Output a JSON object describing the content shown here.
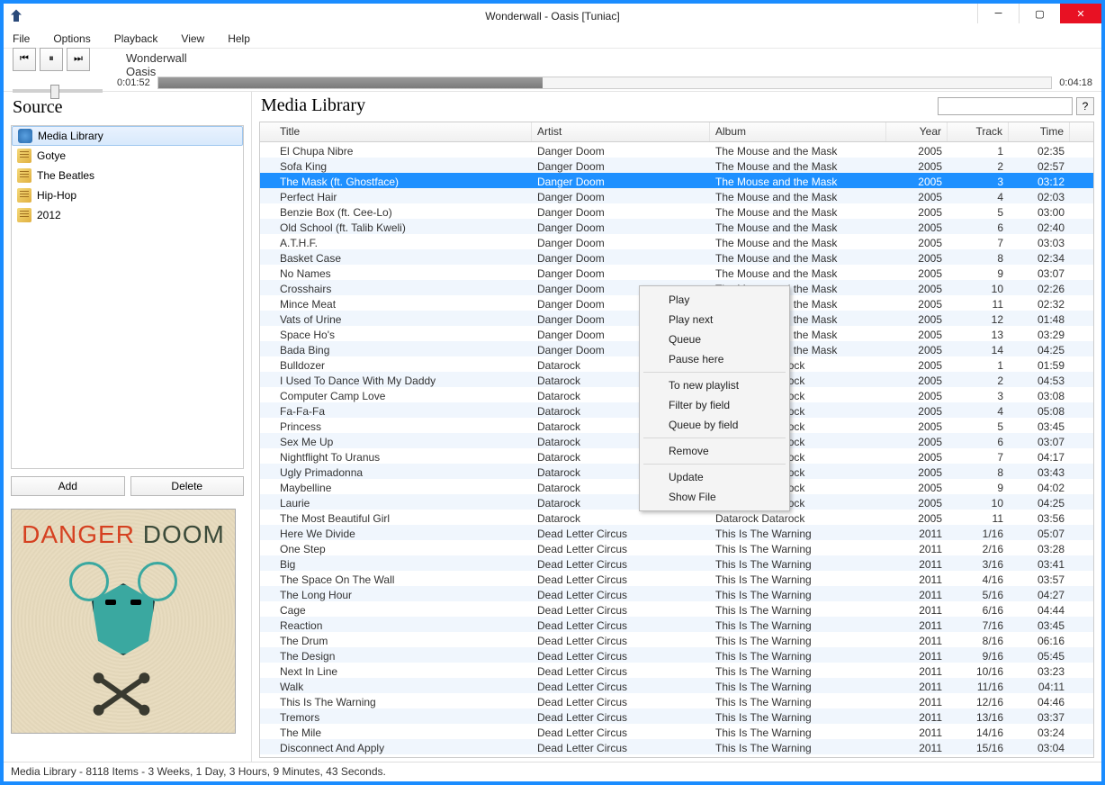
{
  "window": {
    "title": "Wonderwall - Oasis [Tuniac]"
  },
  "menu": {
    "file": "File",
    "options": "Options",
    "playback": "Playback",
    "view": "View",
    "help": "Help"
  },
  "player": {
    "track_title": "Wonderwall",
    "track_artist": "Oasis",
    "elapsed": "0:01:52",
    "total": "0:04:18"
  },
  "sidebar": {
    "head": "Source",
    "items": [
      {
        "label": "Media Library",
        "icon": "library",
        "selected": true
      },
      {
        "label": "Gotye",
        "icon": "playlist"
      },
      {
        "label": "The Beatles",
        "icon": "playlist"
      },
      {
        "label": "Hip-Hop",
        "icon": "playlist"
      },
      {
        "label": "2012",
        "icon": "playlist"
      }
    ],
    "add": "Add",
    "delete": "Delete",
    "art_text1": "DANGER",
    "art_text2": "DOOM"
  },
  "content": {
    "head": "Media Library",
    "help": "?",
    "columns": {
      "title": "Title",
      "artist": "Artist",
      "album": "Album",
      "year": "Year",
      "track": "Track",
      "time": "Time"
    }
  },
  "context_menu": [
    "Play",
    "Play next",
    "Queue",
    "Pause here",
    "-",
    "To new playlist",
    "Filter by field",
    "Queue by field",
    "-",
    "Remove",
    "-",
    "Update",
    "Show File"
  ],
  "tracks": [
    {
      "title": "El Chupa Nibre",
      "artist": "Danger Doom",
      "album": "The Mouse and the Mask",
      "year": "2005",
      "track": "1",
      "time": "02:35"
    },
    {
      "title": "Sofa King",
      "artist": "Danger Doom",
      "album": "The Mouse and the Mask",
      "year": "2005",
      "track": "2",
      "time": "02:57"
    },
    {
      "title": "The Mask (ft. Ghostface)",
      "artist": "Danger Doom",
      "album": "The Mouse and the Mask",
      "year": "2005",
      "track": "3",
      "time": "03:12",
      "selected": true
    },
    {
      "title": "Perfect Hair",
      "artist": "Danger Doom",
      "album": "The Mouse and the Mask",
      "year": "2005",
      "track": "4",
      "time": "02:03"
    },
    {
      "title": "Benzie Box (ft. Cee-Lo)",
      "artist": "Danger Doom",
      "album": "The Mouse and the Mask",
      "year": "2005",
      "track": "5",
      "time": "03:00"
    },
    {
      "title": "Old School (ft. Talib Kweli)",
      "artist": "Danger Doom",
      "album": "The Mouse and the Mask",
      "year": "2005",
      "track": "6",
      "time": "02:40"
    },
    {
      "title": "A.T.H.F.",
      "artist": "Danger Doom",
      "album": "The Mouse and the Mask",
      "year": "2005",
      "track": "7",
      "time": "03:03"
    },
    {
      "title": "Basket Case",
      "artist": "Danger Doom",
      "album": "The Mouse and the Mask",
      "year": "2005",
      "track": "8",
      "time": "02:34"
    },
    {
      "title": "No Names",
      "artist": "Danger Doom",
      "album": "The Mouse and the Mask",
      "year": "2005",
      "track": "9",
      "time": "03:07"
    },
    {
      "title": "Crosshairs",
      "artist": "Danger Doom",
      "album": "The Mouse and the Mask",
      "year": "2005",
      "track": "10",
      "time": "02:26"
    },
    {
      "title": "Mince Meat",
      "artist": "Danger Doom",
      "album": "The Mouse and the Mask",
      "year": "2005",
      "track": "11",
      "time": "02:32"
    },
    {
      "title": "Vats of Urine",
      "artist": "Danger Doom",
      "album": "The Mouse and the Mask",
      "year": "2005",
      "track": "12",
      "time": "01:48"
    },
    {
      "title": "Space Ho's",
      "artist": "Danger Doom",
      "album": "The Mouse and the Mask",
      "year": "2005",
      "track": "13",
      "time": "03:29"
    },
    {
      "title": "Bada Bing",
      "artist": "Danger Doom",
      "album": "The Mouse and the Mask",
      "year": "2005",
      "track": "14",
      "time": "04:25"
    },
    {
      "title": "Bulldozer",
      "artist": "Datarock",
      "album": "Datarock Datarock",
      "year": "2005",
      "track": "1",
      "time": "01:59"
    },
    {
      "title": "I Used To Dance With My Daddy",
      "artist": "Datarock",
      "album": "Datarock Datarock",
      "year": "2005",
      "track": "2",
      "time": "04:53"
    },
    {
      "title": "Computer Camp Love",
      "artist": "Datarock",
      "album": "Datarock Datarock",
      "year": "2005",
      "track": "3",
      "time": "03:08"
    },
    {
      "title": "Fa-Fa-Fa",
      "artist": "Datarock",
      "album": "Datarock Datarock",
      "year": "2005",
      "track": "4",
      "time": "05:08"
    },
    {
      "title": "Princess",
      "artist": "Datarock",
      "album": "Datarock Datarock",
      "year": "2005",
      "track": "5",
      "time": "03:45"
    },
    {
      "title": "Sex Me Up",
      "artist": "Datarock",
      "album": "Datarock Datarock",
      "year": "2005",
      "track": "6",
      "time": "03:07"
    },
    {
      "title": "Nightflight To Uranus",
      "artist": "Datarock",
      "album": "Datarock Datarock",
      "year": "2005",
      "track": "7",
      "time": "04:17"
    },
    {
      "title": "Ugly Primadonna",
      "artist": "Datarock",
      "album": "Datarock Datarock",
      "year": "2005",
      "track": "8",
      "time": "03:43"
    },
    {
      "title": "Maybelline",
      "artist": "Datarock",
      "album": "Datarock Datarock",
      "year": "2005",
      "track": "9",
      "time": "04:02"
    },
    {
      "title": "Laurie",
      "artist": "Datarock",
      "album": "Datarock Datarock",
      "year": "2005",
      "track": "10",
      "time": "04:25"
    },
    {
      "title": "The Most Beautiful Girl",
      "artist": "Datarock",
      "album": "Datarock Datarock",
      "year": "2005",
      "track": "11",
      "time": "03:56"
    },
    {
      "title": "Here We Divide",
      "artist": "Dead Letter Circus",
      "album": "This Is The Warning",
      "year": "2011",
      "track": "1/16",
      "time": "05:07"
    },
    {
      "title": "One Step",
      "artist": "Dead Letter Circus",
      "album": "This Is The Warning",
      "year": "2011",
      "track": "2/16",
      "time": "03:28"
    },
    {
      "title": "Big",
      "artist": "Dead Letter Circus",
      "album": "This Is The Warning",
      "year": "2011",
      "track": "3/16",
      "time": "03:41"
    },
    {
      "title": "The Space On The Wall",
      "artist": "Dead Letter Circus",
      "album": "This Is The Warning",
      "year": "2011",
      "track": "4/16",
      "time": "03:57"
    },
    {
      "title": "The Long Hour",
      "artist": "Dead Letter Circus",
      "album": "This Is The Warning",
      "year": "2011",
      "track": "5/16",
      "time": "04:27"
    },
    {
      "title": "Cage",
      "artist": "Dead Letter Circus",
      "album": "This Is The Warning",
      "year": "2011",
      "track": "6/16",
      "time": "04:44"
    },
    {
      "title": "Reaction",
      "artist": "Dead Letter Circus",
      "album": "This Is The Warning",
      "year": "2011",
      "track": "7/16",
      "time": "03:45"
    },
    {
      "title": "The Drum",
      "artist": "Dead Letter Circus",
      "album": "This Is The Warning",
      "year": "2011",
      "track": "8/16",
      "time": "06:16"
    },
    {
      "title": "The Design",
      "artist": "Dead Letter Circus",
      "album": "This Is The Warning",
      "year": "2011",
      "track": "9/16",
      "time": "05:45"
    },
    {
      "title": "Next In Line",
      "artist": "Dead Letter Circus",
      "album": "This Is The Warning",
      "year": "2011",
      "track": "10/16",
      "time": "03:23"
    },
    {
      "title": "Walk",
      "artist": "Dead Letter Circus",
      "album": "This Is The Warning",
      "year": "2011",
      "track": "11/16",
      "time": "04:11"
    },
    {
      "title": "This Is The Warning",
      "artist": "Dead Letter Circus",
      "album": "This Is The Warning",
      "year": "2011",
      "track": "12/16",
      "time": "04:46"
    },
    {
      "title": "Tremors",
      "artist": "Dead Letter Circus",
      "album": "This Is The Warning",
      "year": "2011",
      "track": "13/16",
      "time": "03:37"
    },
    {
      "title": "The Mile",
      "artist": "Dead Letter Circus",
      "album": "This Is The Warning",
      "year": "2011",
      "track": "14/16",
      "time": "03:24"
    },
    {
      "title": "Disconnect And Apply",
      "artist": "Dead Letter Circus",
      "album": "This Is The Warning",
      "year": "2011",
      "track": "15/16",
      "time": "03:04"
    }
  ],
  "status": "Media Library - 8118 Items - 3 Weeks, 1 Day, 3 Hours, 9 Minutes, 43 Seconds."
}
